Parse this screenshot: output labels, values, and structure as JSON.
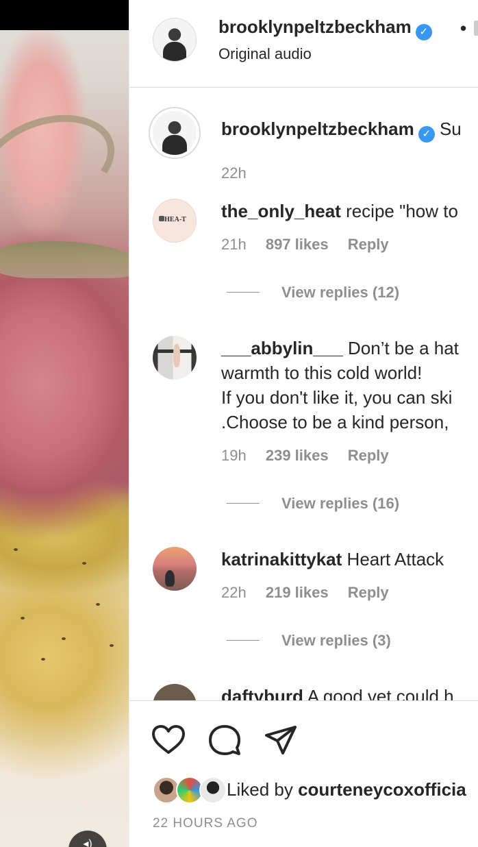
{
  "header": {
    "username": "brooklynpeltzbeckham",
    "dot": "•",
    "subtitle": "Original audio"
  },
  "caption": {
    "username": "brooklynpeltzbeckham",
    "text": "Su",
    "time": "22h"
  },
  "comments": [
    {
      "username": "the_only_heat",
      "lines": [
        "recipe \"how to"
      ],
      "time": "21h",
      "likes": "897 likes",
      "reply": "Reply",
      "view_replies": "View replies (12)",
      "avatar_text": "HEA-T"
    },
    {
      "username": "___abbylin___",
      "lines": [
        "Don’t be a hat",
        "warmth to this cold world!",
        "If you don't like it, you can ski",
        ".Choose to be a kind person,"
      ],
      "time": "19h",
      "likes": "239 likes",
      "reply": "Reply",
      "view_replies": "View replies (16)"
    },
    {
      "username": "katrinakittykat",
      "lines": [
        "Heart Attack"
      ],
      "time": "22h",
      "likes": "219 likes",
      "reply": "Reply",
      "view_replies": "View replies (3)"
    },
    {
      "username": "daftyburd",
      "lines": [
        "A good vet could h"
      ]
    }
  ],
  "actions": {
    "icons": [
      "heart-icon",
      "comment-icon",
      "share-icon"
    ],
    "liked_prefix": "Liked by ",
    "liked_user": "courteneycoxofficia",
    "timestamp": "22 HOURS AGO"
  },
  "media": {
    "icon": "speaker-muted-icon",
    "mute_glyph": "◂)"
  },
  "colors": {
    "verified": "#3897f0",
    "secondary_text": "#8e8e8e",
    "divider": "#dbdbdb"
  }
}
